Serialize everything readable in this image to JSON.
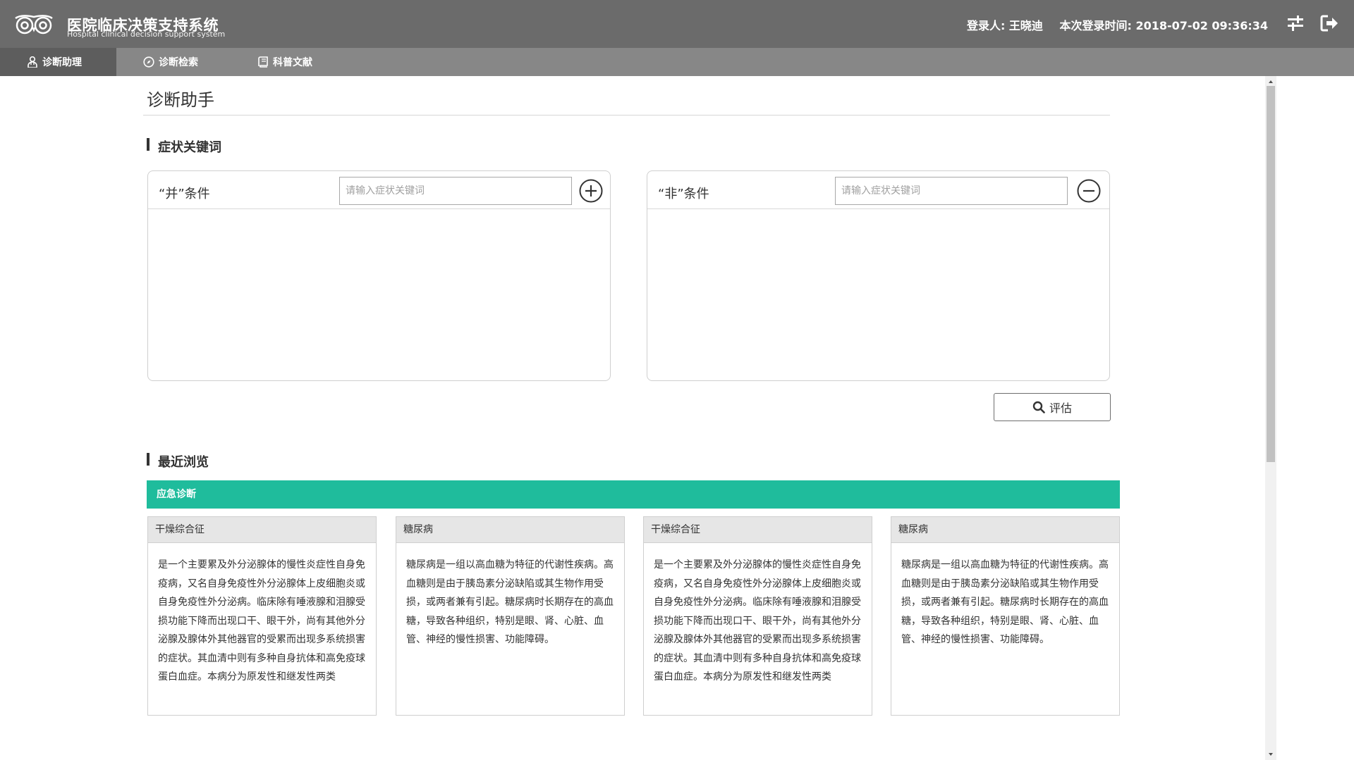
{
  "app": {
    "title": "医院临床决策支持系统",
    "subtitle": "Hospital clinical decision support system",
    "logo_icon": "owl-eyes-logo"
  },
  "header": {
    "user_label": "登录人: 王晓迪",
    "login_time_label": "本次登录时间: 2018-07-02 09:36:34",
    "settings_icon": "sliders-icon",
    "logout_icon": "logout-icon"
  },
  "nav": {
    "tabs": [
      {
        "label": "诊断助理",
        "icon": "doctor-icon",
        "active": true
      },
      {
        "label": "诊断检索",
        "icon": "compass-icon",
        "active": false
      },
      {
        "label": "科普文献",
        "icon": "book-icon",
        "active": false
      }
    ]
  },
  "main": {
    "page_title": "诊断助手",
    "symptom_section_title": "症状关键词",
    "and_condition": {
      "label": "“并”条件",
      "placeholder": "请输入症状关键词",
      "value": "",
      "button_icon": "plus-circle-icon"
    },
    "not_condition": {
      "label": "“非”条件",
      "placeholder": "请输入症状关键词",
      "value": "",
      "button_icon": "minus-circle-icon"
    },
    "evaluate_button": "评估",
    "recent_section_title": "最近浏览",
    "emergency_label": "应急诊断",
    "cards": [
      {
        "title": "干燥综合征",
        "body": "是一个主要累及外分泌腺体的慢性炎症性自身免疫病，又名自身免疫性外分泌腺体上皮细胞炎或自身免疫性外分泌病。临床除有唾液腺和泪腺受损功能下降而出现口干、眼干外，尚有其他外分泌腺及腺体外其他器官的受累而出现多系统损害的症状。其血清中则有多种自身抗体和高免疫球蛋白血症。本病分为原发性和继发性两类"
      },
      {
        "title": "糖尿病",
        "body": "糖尿病是一组以高血糖为特征的代谢性疾病。高血糖则是由于胰岛素分泌缺陷或其生物作用受损，或两者兼有引起。糖尿病时长期存在的高血糖，导致各种组织，特别是眼、肾、心脏、血管、神经的慢性损害、功能障碍。"
      },
      {
        "title": "干燥综合征",
        "body": "是一个主要累及外分泌腺体的慢性炎症性自身免疫病，又名自身免疫性外分泌腺体上皮细胞炎或自身免疫性外分泌病。临床除有唾液腺和泪腺受损功能下降而出现口干、眼干外，尚有其他外分泌腺及腺体外其他器官的受累而出现多系统损害的症状。其血清中则有多种自身抗体和高免疫球蛋白血症。本病分为原发性和继发性两类"
      },
      {
        "title": "糖尿病",
        "body": "糖尿病是一组以高血糖为特征的代谢性疾病。高血糖则是由于胰岛素分泌缺陷或其生物作用受损，或两者兼有引起。糖尿病时长期存在的高血糖，导致各种组织，特别是眼、肾、心脏、血管、神经的慢性损害、功能障碍。"
      }
    ]
  },
  "colors": {
    "header_bg": "#6b6b6b",
    "nav_bg": "#878787",
    "nav_active_bg": "#5d5d5d",
    "accent": "#1fbc9c"
  }
}
